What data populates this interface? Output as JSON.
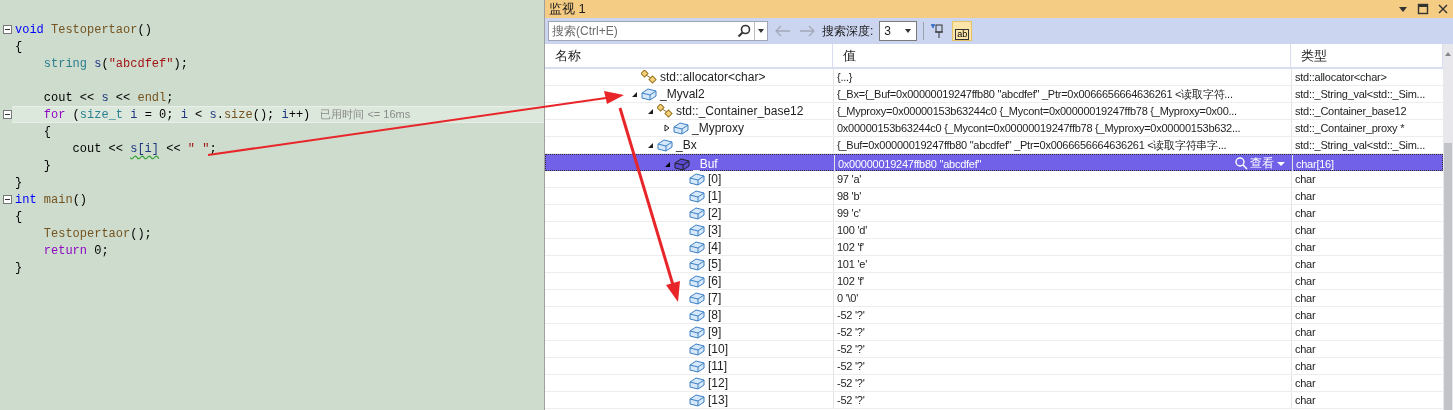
{
  "editor": {
    "lines": [
      {
        "kind": "code",
        "fold": true,
        "current": false,
        "tokens": [
          {
            "text": "void",
            "kind": "keyword"
          },
          {
            "text": " Testopertaor",
            "kind": "func"
          },
          {
            "text": "()",
            "kind": "plain"
          }
        ]
      },
      {
        "kind": "code",
        "fold": false,
        "current": false,
        "tokens": [
          {
            "text": "{",
            "kind": "plain"
          }
        ]
      },
      {
        "kind": "code",
        "fold": false,
        "current": false,
        "tokens": [
          {
            "text": "    string",
            "kind": "type"
          },
          {
            "text": " s",
            "kind": "var"
          },
          {
            "text": "(",
            "kind": "plain"
          },
          {
            "text": "\"abcdfef\"",
            "kind": "string"
          },
          {
            "text": ");",
            "kind": "plain"
          }
        ]
      },
      {
        "kind": "blank"
      },
      {
        "kind": "code",
        "fold": false,
        "current": false,
        "tokens": [
          {
            "text": "    cout << ",
            "kind": "plain"
          },
          {
            "text": "s",
            "kind": "var"
          },
          {
            "text": " << ",
            "kind": "plain"
          },
          {
            "text": "endl",
            "kind": "func"
          },
          {
            "text": ";",
            "kind": "plain"
          }
        ]
      },
      {
        "kind": "code",
        "fold": true,
        "current": true,
        "hint": "已用时间 <= 16ms",
        "tokens": [
          {
            "text": "    for",
            "kind": "control"
          },
          {
            "text": " (",
            "kind": "plain"
          },
          {
            "text": "size_t",
            "kind": "type"
          },
          {
            "text": " i",
            "kind": "var"
          },
          {
            "text": " = 0; ",
            "kind": "plain"
          },
          {
            "text": "i",
            "kind": "var"
          },
          {
            "text": " < ",
            "kind": "plain"
          },
          {
            "text": "s",
            "kind": "var"
          },
          {
            "text": ".",
            "kind": "plain"
          },
          {
            "text": "size",
            "kind": "func"
          },
          {
            "text": "(); ",
            "kind": "plain"
          },
          {
            "text": "i",
            "kind": "var"
          },
          {
            "text": "++)",
            "kind": "plain"
          }
        ]
      },
      {
        "kind": "code",
        "fold": false,
        "current": false,
        "tokens": [
          {
            "text": "    {",
            "kind": "plain"
          }
        ]
      },
      {
        "kind": "code",
        "fold": false,
        "current": false,
        "tokens": [
          {
            "text": "        cout << ",
            "kind": "plain"
          },
          {
            "text": "s[i]",
            "kind": "var",
            "squiggle": true
          },
          {
            "text": " << ",
            "kind": "plain"
          },
          {
            "text": "\" \"",
            "kind": "string"
          },
          {
            "text": ";",
            "kind": "plain"
          }
        ]
      },
      {
        "kind": "code",
        "fold": false,
        "current": false,
        "tokens": [
          {
            "text": "    }",
            "kind": "plain"
          }
        ]
      },
      {
        "kind": "code",
        "fold": false,
        "current": false,
        "tokens": [
          {
            "text": "}",
            "kind": "plain"
          }
        ]
      },
      {
        "kind": "code",
        "fold": true,
        "current": false,
        "tokens": [
          {
            "text": "int",
            "kind": "keyword"
          },
          {
            "text": " main",
            "kind": "func"
          },
          {
            "text": "()",
            "kind": "plain"
          }
        ]
      },
      {
        "kind": "code",
        "fold": false,
        "current": false,
        "tokens": [
          {
            "text": "{",
            "kind": "plain"
          }
        ]
      },
      {
        "kind": "code",
        "fold": false,
        "current": false,
        "tokens": [
          {
            "text": "    Testopertaor",
            "kind": "func"
          },
          {
            "text": "();",
            "kind": "plain"
          }
        ]
      },
      {
        "kind": "code",
        "fold": false,
        "current": false,
        "tokens": [
          {
            "text": "    return",
            "kind": "control"
          },
          {
            "text": " 0;",
            "kind": "plain"
          }
        ]
      },
      {
        "kind": "code",
        "fold": false,
        "current": false,
        "tokens": [
          {
            "text": "}",
            "kind": "plain"
          }
        ]
      }
    ]
  },
  "watch": {
    "title": "监视 1",
    "toolbar": {
      "search": {
        "placeholder": "搜索(Ctrl+E)"
      },
      "back_disabled": true,
      "forward_disabled": true,
      "depth_label": "搜索深度:",
      "depth_value": "3",
      "hex_toggle": {
        "label": "ab",
        "selected": true
      }
    },
    "columns": [
      "名称",
      "值",
      "类型"
    ],
    "rows": [
      {
        "name": "std::allocator<char>",
        "kind": "base",
        "value": "{...}",
        "type": "std::allocator<char>",
        "selected": false
      },
      {
        "name": "_Myval2",
        "kind": "field",
        "value": "{_Bx={_Buf=0x00000019247ffb80 \"abcdfef\" _Ptr=0x0066656664636261 <读取字符...",
        "type": "std::_String_val<std::_Sim...",
        "selected": false,
        "expanded": true,
        "children": [
          {
            "name": "std::_Container_base12",
            "kind": "base",
            "value": "{_Myproxy=0x00000153b63244c0 {_Mycont=0x00000019247ffb78 {_Myproxy=0x00...",
            "type": "std::_Container_base12",
            "selected": false,
            "expanded": true,
            "children": [
              {
                "name": "_Myproxy",
                "kind": "field",
                "value": "0x00000153b63244c0 {_Mycont=0x00000019247ffb78 {_Myproxy=0x00000153b632...",
                "type": "std::_Container_proxy *",
                "selected": false,
                "expanded": false
              }
            ]
          },
          {
            "name": "_Bx",
            "kind": "field",
            "value": "{_Buf=0x00000019247ffb80 \"abcdfef\" _Ptr=0x0066656664636261 <读取字符串字...",
            "type": "std::_String_val<std::_Sim...",
            "selected": false,
            "expanded": true,
            "children": [
              {
                "name": "_Buf",
                "kind": "field",
                "value": "0x00000019247ffb80 \"abcdfef\"",
                "visualizer": "查看",
                "type": "char[16]",
                "selected": true,
                "expanded": true,
                "children": [
                  {
                    "name": "[0]",
                    "kind": "field",
                    "value": "97 'a'",
                    "type": "char",
                    "selected": false
                  },
                  {
                    "name": "[1]",
                    "kind": "field",
                    "value": "98 'b'",
                    "type": "char",
                    "selected": false
                  },
                  {
                    "name": "[2]",
                    "kind": "field",
                    "value": "99 'c'",
                    "type": "char",
                    "selected": false
                  },
                  {
                    "name": "[3]",
                    "kind": "field",
                    "value": "100 'd'",
                    "type": "char",
                    "selected": false
                  },
                  {
                    "name": "[4]",
                    "kind": "field",
                    "value": "102 'f'",
                    "type": "char",
                    "selected": false
                  },
                  {
                    "name": "[5]",
                    "kind": "field",
                    "value": "101 'e'",
                    "type": "char",
                    "selected": false
                  },
                  {
                    "name": "[6]",
                    "kind": "field",
                    "value": "102 'f'",
                    "type": "char",
                    "selected": false
                  },
                  {
                    "name": "[7]",
                    "kind": "field",
                    "value": "0 '\\0'",
                    "type": "char",
                    "selected": false
                  },
                  {
                    "name": "[8]",
                    "kind": "field",
                    "value": "-52 '?'",
                    "type": "char",
                    "selected": false
                  },
                  {
                    "name": "[9]",
                    "kind": "field",
                    "value": "-52 '?'",
                    "type": "char",
                    "selected": false
                  },
                  {
                    "name": "[10]",
                    "kind": "field",
                    "value": "-52 '?'",
                    "type": "char",
                    "selected": false
                  },
                  {
                    "name": "[11]",
                    "kind": "field",
                    "value": "-52 '?'",
                    "type": "char",
                    "selected": false
                  },
                  {
                    "name": "[12]",
                    "kind": "field",
                    "value": "-52 '?'",
                    "type": "char",
                    "selected": false
                  },
                  {
                    "name": "[13]",
                    "kind": "field",
                    "value": "-52 '?'",
                    "type": "char",
                    "selected": false
                  }
                ]
              }
            ]
          }
        ]
      }
    ]
  }
}
